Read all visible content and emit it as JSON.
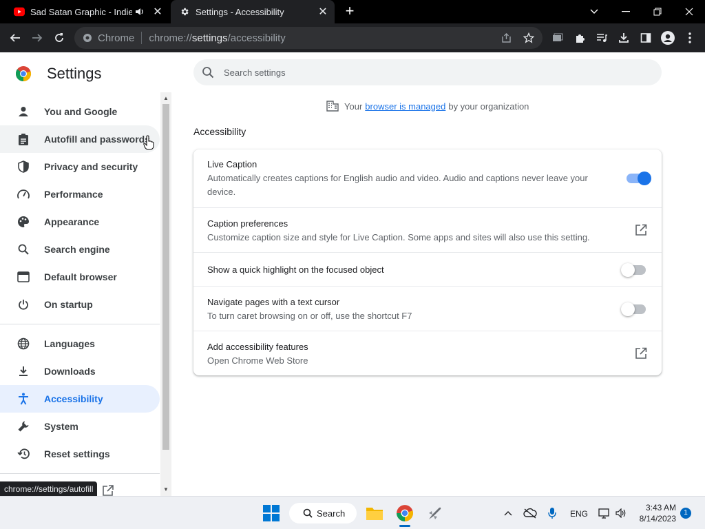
{
  "tabs": [
    {
      "title": "Sad Satan Graphic - Indie Horror",
      "icon": "youtube-icon",
      "audio_icon": "speaker-icon"
    },
    {
      "title": "Settings - Accessibility",
      "icon": "gear-icon"
    }
  ],
  "omnibox": {
    "site_label": "Chrome",
    "url_prefix": "chrome://",
    "url_host": "settings",
    "url_path": "/accessibility"
  },
  "sidebar": {
    "title": "Settings",
    "items": [
      {
        "label": "You and Google",
        "icon": "person-icon"
      },
      {
        "label": "Autofill and passwords",
        "icon": "clipboard-icon"
      },
      {
        "label": "Privacy and security",
        "icon": "shield-icon"
      },
      {
        "label": "Performance",
        "icon": "speedometer-icon"
      },
      {
        "label": "Appearance",
        "icon": "palette-icon"
      },
      {
        "label": "Search engine",
        "icon": "search-icon"
      },
      {
        "label": "Default browser",
        "icon": "browser-window-icon"
      },
      {
        "label": "On startup",
        "icon": "power-icon"
      },
      {
        "label": "Languages",
        "icon": "globe-icon"
      },
      {
        "label": "Downloads",
        "icon": "download-icon"
      },
      {
        "label": "Accessibility",
        "icon": "accessibility-icon"
      },
      {
        "label": "System",
        "icon": "wrench-icon"
      },
      {
        "label": "Reset settings",
        "icon": "history-icon"
      }
    ]
  },
  "status_url": "chrome://settings/autofill",
  "search": {
    "placeholder": "Search settings"
  },
  "managed": {
    "prefix": "Your",
    "link": "browser is managed",
    "suffix": "by your organization"
  },
  "section_title": "Accessibility",
  "settings": [
    {
      "title": "Live Caption",
      "subtitle": "Automatically creates captions for English audio and video. Audio and captions never leave your device.",
      "control": "toggle",
      "state": "on"
    },
    {
      "title": "Caption preferences",
      "subtitle": "Customize caption size and style for Live Caption. Some apps and sites will also use this setting.",
      "control": "external-link"
    },
    {
      "title": "Show a quick highlight on the focused object",
      "subtitle": "",
      "control": "toggle",
      "state": "off"
    },
    {
      "title": "Navigate pages with a text cursor",
      "subtitle": "To turn caret browsing on or off, use the shortcut F7",
      "control": "toggle",
      "state": "off"
    },
    {
      "title": "Add accessibility features",
      "subtitle": "Open Chrome Web Store",
      "control": "external-link"
    }
  ],
  "taskbar": {
    "search_label": "Search",
    "language": "ENG",
    "time": "3:43 AM",
    "date": "8/14/2023",
    "notifications": "1"
  },
  "colors": {
    "accent": "#1a73e8",
    "selected_bg": "#e8f0fe",
    "tab_bar": "#000000",
    "toolbar": "#202124"
  }
}
